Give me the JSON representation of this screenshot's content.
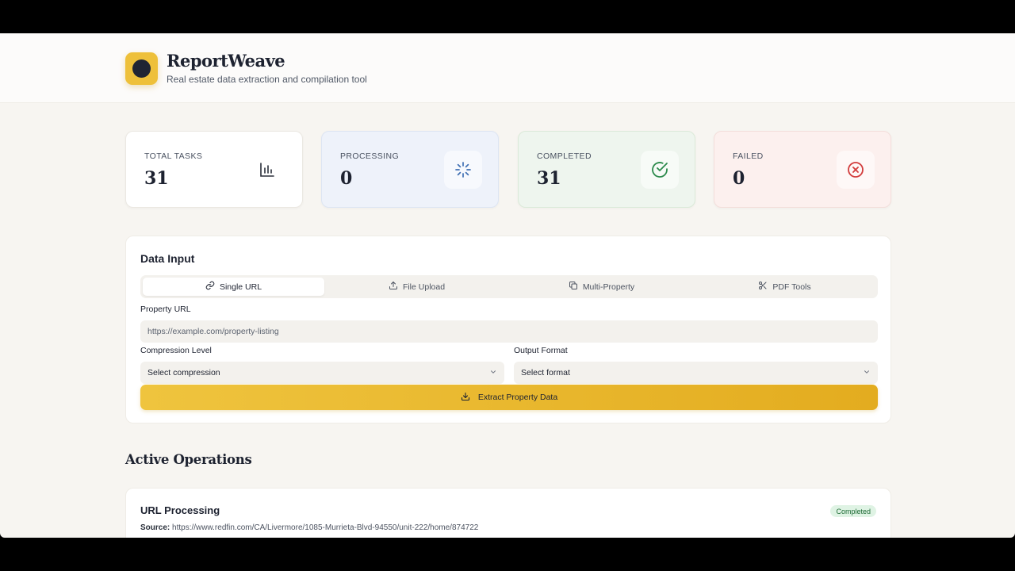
{
  "app": {
    "title": "ReportWeave",
    "subtitle": "Real estate data extraction and compilation tool",
    "accent_color": "#eec03a"
  },
  "stats": [
    {
      "label": "TOTAL TASKS",
      "value": "31",
      "icon": "bar-chart-icon"
    },
    {
      "label": "PROCESSING",
      "value": "0",
      "icon": "spinner-icon"
    },
    {
      "label": "COMPLETED",
      "value": "31",
      "icon": "check-circle-icon"
    },
    {
      "label": "FAILED",
      "value": "0",
      "icon": "x-circle-icon"
    }
  ],
  "data_input": {
    "title": "Data Input",
    "tabs": [
      {
        "label": "Single URL",
        "icon": "link-icon",
        "active": true
      },
      {
        "label": "File Upload",
        "icon": "upload-icon",
        "active": false
      },
      {
        "label": "Multi-Property",
        "icon": "copy-icon",
        "active": false
      },
      {
        "label": "PDF Tools",
        "icon": "scissors-icon",
        "active": false
      }
    ],
    "url_label": "Property URL",
    "url_placeholder": "https://example.com/property-listing",
    "compression_label": "Compression Level",
    "compression_value": "Select compression",
    "format_label": "Output Format",
    "format_value": "Select format",
    "button_label": "Extract Property Data"
  },
  "operations": {
    "title": "Active Operations",
    "items": [
      {
        "title": "URL Processing",
        "status": "Completed",
        "source_label": "Source:",
        "source_url": "https://www.redfin.com/CA/Livermore/1085-Murrieta-Blvd-94550/unit-222/home/874722"
      }
    ]
  }
}
